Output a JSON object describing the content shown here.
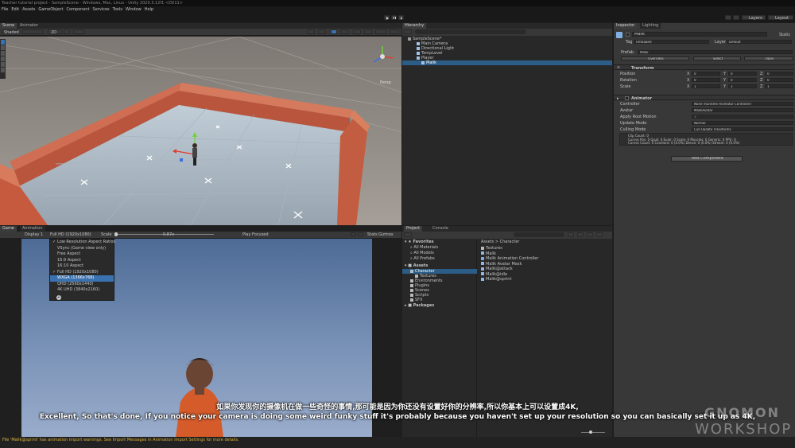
{
  "window": {
    "title": "Teacher tutorial project - SampleScene - Windows, Mac, Linux - Unity 2020.3.12f1 <DX11>"
  },
  "menu": [
    "File",
    "Edit",
    "Assets",
    "GameObject",
    "Component",
    "Services",
    "Tools",
    "Window",
    "Help"
  ],
  "toolbar": {
    "layers": "Layers",
    "layout": "Layout"
  },
  "scene_view": {
    "tabs": [
      "Scene",
      "Animator"
    ],
    "shading": "Shaded",
    "mode_2d": "2D",
    "persp_label": "Persp"
  },
  "hierarchy": {
    "tab": "Hierarchy",
    "items": [
      "SampleScene*",
      "Main Camera",
      "Directional Light",
      "TempLevel",
      "Player",
      "Malik"
    ]
  },
  "game_view": {
    "tabs": [
      "Game",
      "Animation"
    ],
    "display": "Display 1",
    "resolution": "Full HD (1920x1080)",
    "scale_label": "Scale",
    "scale_value": "0.87x",
    "play_focused": "Play Focused",
    "stats": "Stats",
    "gizmos": "Gizmos",
    "dropdown": [
      {
        "label": "Low Resolution Aspect Ratios",
        "checked": true
      },
      {
        "label": "VSync (Game view only)",
        "checked": false
      },
      {
        "label": "Free Aspect",
        "checked": false
      },
      {
        "label": "16:9 Aspect",
        "checked": false
      },
      {
        "label": "16:10 Aspect",
        "checked": false
      },
      {
        "label": "Full HD (1920x1080)",
        "checked": true
      },
      {
        "label": "WXGA (1366x768)",
        "checked": false
      },
      {
        "label": "QHD (2560x1440)",
        "checked": false
      },
      {
        "label": "4K UHD (3840x2160)",
        "checked": false
      }
    ],
    "dropdown_add": "+"
  },
  "project": {
    "tabs": [
      "Project",
      "Console"
    ],
    "favorites": "Favorites",
    "fav_items": [
      "All Materials",
      "All Models",
      "All Prefabs"
    ],
    "assets": "Assets",
    "asset_tree": [
      "Character",
      "Textures",
      "Environments",
      "Plugins",
      "Scenes",
      "Scripts",
      "SFX"
    ],
    "packages": "Packages",
    "breadcrumb": "Assets > Character",
    "files": [
      "Textures",
      "Malik",
      "Malik Animation Controller",
      "Malik Avatar Mask",
      "Malik@attack",
      "Malik@idle",
      "Malik@sprint"
    ]
  },
  "inspector": {
    "tabs": [
      "Inspector",
      "Lighting"
    ],
    "object_name": "Malik",
    "static": "Static",
    "tag_label": "Tag",
    "tag_value": "Untagged",
    "layer_label": "Layer",
    "layer_value": "Default",
    "prefab_label": "Prefab",
    "prefab_value": "Malik",
    "overrides": "Overrides",
    "select": "Select",
    "open": "Open",
    "transform": {
      "title": "Transform",
      "rows": [
        {
          "label": "Position",
          "x": "0",
          "y": "0",
          "z": "0"
        },
        {
          "label": "Rotation",
          "x": "0",
          "y": "0",
          "z": "0"
        },
        {
          "label": "Scale",
          "x": "1",
          "y": "1",
          "z": "1"
        }
      ]
    },
    "animator": {
      "title": "Animator",
      "rows": [
        {
          "label": "Controller",
          "value": "None (Runtime Animator Controller)"
        },
        {
          "label": "Avatar",
          "value": "MalikAvatar"
        },
        {
          "label": "Apply Root Motion",
          "value": "✓"
        },
        {
          "label": "Update Mode",
          "value": "Normal"
        },
        {
          "label": "Culling Mode",
          "value": "Cull Update Transforms"
        }
      ],
      "info": [
        "Clip Count: 0",
        "Curves Pos: 0 Quat: 0 Euler: 0 Scale: 0 Muscles: 0 Generic: 0 PPtr: 0",
        "Curves Count: 0 Constant: 0 (0.0%) Dense: 0 (0.0%) Stream: 0 (0.0%)"
      ]
    },
    "add_component": "Add Component"
  },
  "status_bar": {
    "message": "File 'Malik@sprint' has animation import warnings. See Import Messages in Animation Import Settings for more details."
  },
  "subtitles": {
    "zh": "如果你发现你的摄像机在做一些奇怪的事情,那可能是因为你还没有设置好你的分辨率,所以你基本上可以设置成4K,",
    "en": "Excellent, So that's done, If you notice your camera is doing some weird funky stuff it's probably because you haven't set up your resolution so you can basically set it up as 4K,"
  },
  "watermark": {
    "line1": "GNOMON",
    "line2": "WORKSHOP"
  },
  "colors": {
    "accent": "#3a72b0",
    "selection": "#2c5d87",
    "bg": "#282828"
  }
}
